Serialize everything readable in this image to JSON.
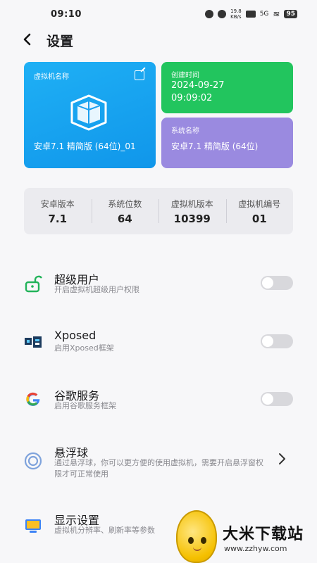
{
  "status_bar": {
    "time": "09:10",
    "net_speed": "19.8\nKB/s",
    "hd": "HD",
    "signal": "5G",
    "battery": "95"
  },
  "header": {
    "title": "设置",
    "back_icon": "chevron-left-icon"
  },
  "vm_card": {
    "label": "虚拟机名称",
    "name": "安卓7.1 精简版 (64位)_01",
    "color": "#1a9ff0"
  },
  "time_card": {
    "label": "创建时间",
    "date": "2024-09-27",
    "time": "09:09:02",
    "color": "#22c55e"
  },
  "system_card": {
    "label": "系统名称",
    "value": "安卓7.1 精简版 (64位)",
    "color": "#9a8ae0"
  },
  "stats": [
    {
      "label": "安卓版本",
      "value": "7.1"
    },
    {
      "label": "系统位数",
      "value": "64"
    },
    {
      "label": "虚拟机版本",
      "value": "10399"
    },
    {
      "label": "虚拟机编号",
      "value": "01"
    }
  ],
  "settings": [
    {
      "title": "超级用户",
      "subtitle": "开启虚拟机超级用户权限",
      "icon": "unlock-icon",
      "control": "toggle",
      "enabled": false
    },
    {
      "title": "Xposed",
      "subtitle": "启用Xposed框架",
      "icon": "xposed-icon",
      "control": "toggle",
      "enabled": false
    },
    {
      "title": "谷歌服务",
      "subtitle": "启用谷歌服务框架",
      "icon": "google-icon",
      "control": "toggle",
      "enabled": false
    },
    {
      "title": "悬浮球",
      "subtitle": "通过悬浮球，你可以更方便的使用虚拟机，需要开启悬浮窗权限才可正常使用",
      "icon": "floating-ball-icon",
      "control": "chevron"
    },
    {
      "title": "显示设置",
      "subtitle": "虚拟机分辨率、刷新率等参数",
      "icon": "monitor-icon",
      "control": "none"
    }
  ],
  "watermark": {
    "title": "大米下载站",
    "url": "www.zzhyw.com"
  }
}
